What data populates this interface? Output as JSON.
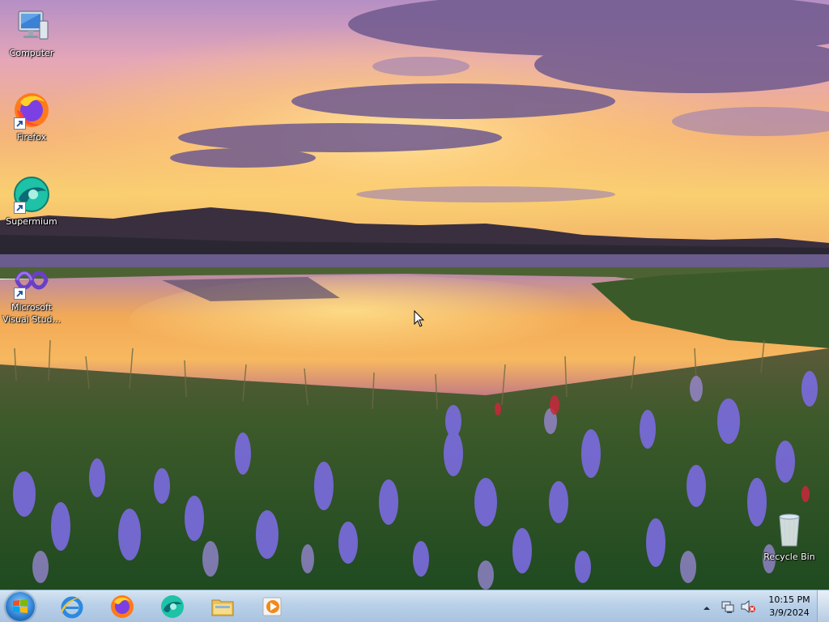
{
  "desktop": {
    "icons": [
      {
        "label": "Computer",
        "icon": "computer-icon"
      },
      {
        "label": "Firefox",
        "icon": "firefox-icon"
      },
      {
        "label": "Supermium",
        "icon": "supermium-icon"
      },
      {
        "label": "Microsoft Visual Stud...",
        "icon": "visual-studio-icon"
      },
      {
        "label": "Recycle Bin",
        "icon": "recycle-bin-icon"
      }
    ]
  },
  "taskbar": {
    "start_icon": "windows-logo-icon",
    "pinned": [
      {
        "icon": "internet-explorer-icon"
      },
      {
        "icon": "firefox-icon"
      },
      {
        "icon": "supermium-icon"
      },
      {
        "icon": "file-explorer-icon"
      },
      {
        "icon": "media-player-icon"
      }
    ],
    "tray": {
      "icons": [
        "show-hidden-icons-arrow",
        "network-icon",
        "volume-muted-icon"
      ],
      "time": "10:15 PM",
      "date": "3/9/2024"
    }
  },
  "colors": {
    "taskbar_top": "#d6e4f2",
    "taskbar_bottom": "#a9c3e0",
    "sky_gold": "#f6c05a",
    "sky_purple": "#a989c9",
    "flowers": "#7a6fe0"
  }
}
